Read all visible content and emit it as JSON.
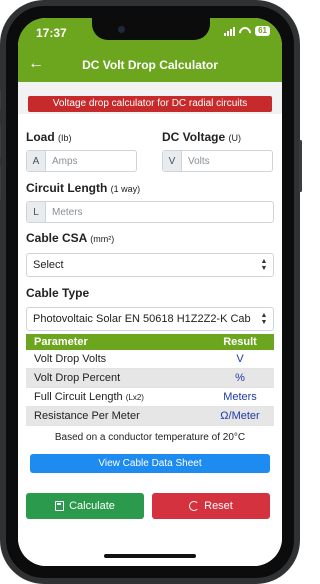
{
  "status": {
    "time": "17:37",
    "battery": "61"
  },
  "appbar": {
    "title": "DC Volt Drop Calculator"
  },
  "subtitle": "Voltage drop calculator for DC radial circuits",
  "load": {
    "label": "Load",
    "unit": "(Ib)",
    "addon": "A",
    "placeholder": "Amps"
  },
  "dc_voltage": {
    "label": "DC Voltage",
    "unit": "(U)",
    "addon": "V",
    "placeholder": "Volts"
  },
  "circuit_length": {
    "label": "Circuit Length",
    "unit": "(1 way)",
    "addon": "L",
    "placeholder": "Meters"
  },
  "cable_csa": {
    "label": "Cable CSA",
    "unit": "(mm²)",
    "selected": "Select"
  },
  "cable_type": {
    "label": "Cable Type",
    "selected": "Photovoltaic Solar EN 50618 H1Z2Z2-K Cab"
  },
  "results": {
    "headers": {
      "parameter": "Parameter",
      "result": "Result"
    },
    "rows": [
      {
        "parameter": "Volt Drop Volts",
        "unit_note": "",
        "result": "V"
      },
      {
        "parameter": "Volt Drop Percent",
        "unit_note": "",
        "result": "%"
      },
      {
        "parameter": "Full Circuit Length",
        "unit_note": "(Lx2)",
        "result": "Meters"
      },
      {
        "parameter": "Resistance Per Meter",
        "unit_note": "",
        "result": "Ω/Meter"
      }
    ]
  },
  "note": "Based on a conductor temperature of 20°C",
  "buttons": {
    "view_sheet": "View Cable Data Sheet",
    "calculate": "Calculate",
    "reset": "Reset"
  },
  "colors": {
    "brand_green": "#6ca51e",
    "alert_red": "#c62a2a",
    "calc_green": "#2c9a4c",
    "reset_red": "#d4323f",
    "link_blue": "#1e8bf0"
  }
}
